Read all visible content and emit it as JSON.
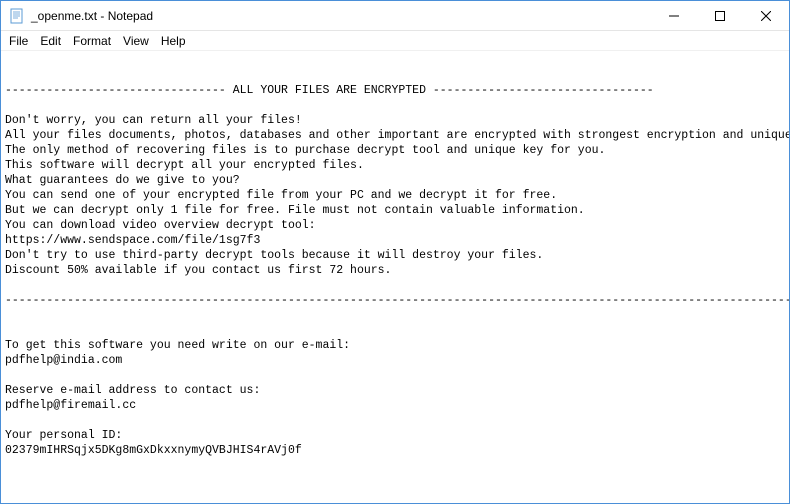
{
  "window": {
    "title": "_openme.txt - Notepad"
  },
  "menu": {
    "file": "File",
    "edit": "Edit",
    "format": "Format",
    "view": "View",
    "help": "Help"
  },
  "content": {
    "line1": "-------------------------------- ALL YOUR FILES ARE ENCRYPTED --------------------------------",
    "line2": "",
    "line3": "Don't worry, you can return all your files!",
    "line4": "All your files documents, photos, databases and other important are encrypted with strongest encryption and unique key.",
    "line5": "The only method of recovering files is to purchase decrypt tool and unique key for you.",
    "line6": "This software will decrypt all your encrypted files.",
    "line7": "What guarantees do we give to you?",
    "line8": "You can send one of your encrypted file from your PC and we decrypt it for free.",
    "line9": "But we can decrypt only 1 file for free. File must not contain valuable information.",
    "line10": "You can download video overview decrypt tool:",
    "line11": "https://www.sendspace.com/file/1sg7f3",
    "line12": "Don't try to use third-party decrypt tools because it will destroy your files.",
    "line13": "Discount 50% available if you contact us first 72 hours.",
    "line14": "",
    "line15": "---------------------------------------------------------------------------------------------------------------------------",
    "line16": "",
    "line17": "",
    "line18": "To get this software you need write on our e-mail:",
    "line19": "pdfhelp@india.com",
    "line20": "",
    "line21": "Reserve e-mail address to contact us:",
    "line22": "pdfhelp@firemail.cc",
    "line23": "",
    "line24": "Your personal ID:",
    "line25": "02379mIHRSqjx5DKg8mGxDkxxnymyQVBJHIS4rAVj0f"
  }
}
